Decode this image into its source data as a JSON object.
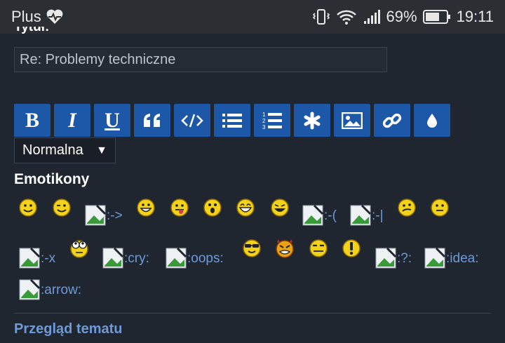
{
  "statusbar": {
    "carrier": "Plus",
    "battery": "69%",
    "time": "19:11"
  },
  "form": {
    "title_label": "Tytuł:",
    "title_value": "Re: Problemy techniczne"
  },
  "toolbar": {
    "buttons": [
      "bold",
      "italic",
      "underline",
      "quote",
      "code",
      "list",
      "numbered-list",
      "asterisk",
      "image",
      "link",
      "color"
    ],
    "bold_label": "B",
    "italic_label": "I",
    "underline_label": "U",
    "font_size": "Normalna",
    "font_size_arrow": "▼"
  },
  "emoticons": {
    "heading": "Emotikony",
    "broken": [
      ":->",
      ":-(",
      ":-|",
      ":-x",
      ":cry:",
      ":oops:",
      ":?:",
      ":idea:",
      ":arrow:"
    ]
  },
  "footer": {
    "review_link": "Przegląd tematu"
  },
  "colors": {
    "background": "#1f2630",
    "button": "#1d58a8",
    "link": "#6e9bd8",
    "smiley": "#f2d21b"
  }
}
